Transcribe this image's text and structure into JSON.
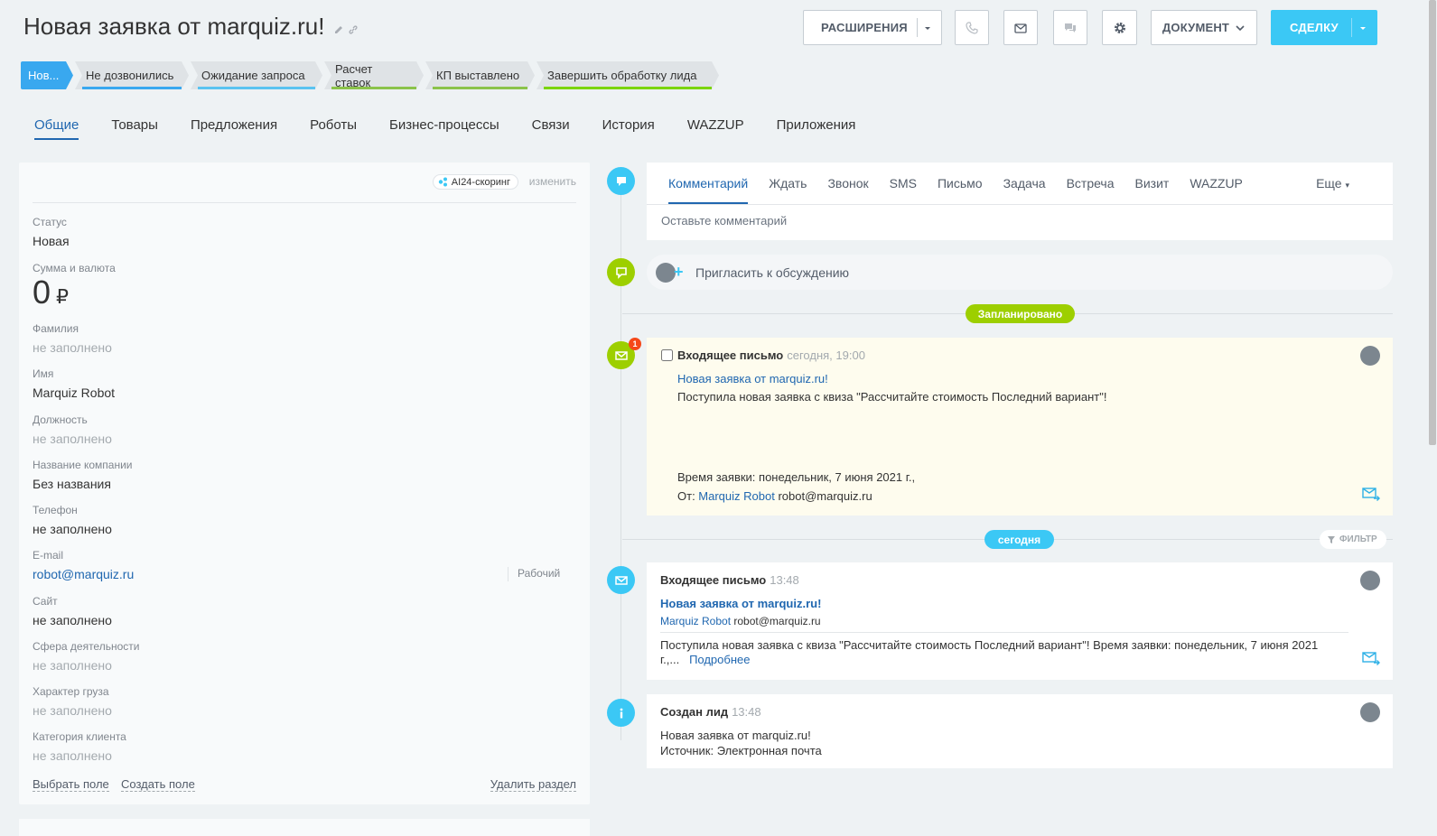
{
  "header": {
    "title": "Новая заявка от  marquiz.ru!",
    "edit_icon": "pencil-icon",
    "link_icon": "link-icon"
  },
  "toolbar": {
    "extensions_label": "РАСШИРЕНИЯ",
    "document_label": "ДОКУМЕНТ",
    "deal_label": "СДЕЛКУ",
    "phone_icon": "phone-icon",
    "mail_icon": "mail-icon",
    "chat_icon": "chat-icon",
    "settings_icon": "gear-icon"
  },
  "stages": [
    {
      "label": "Нов...",
      "color": "#39a8ef",
      "active": true
    },
    {
      "label": "Не дозвонились",
      "color": "#39a8ef"
    },
    {
      "label": "Ожидание запроса",
      "color": "#5ac3f0"
    },
    {
      "label": "Расчет ставок",
      "color": "#8bc34a"
    },
    {
      "label": "КП выставлено",
      "color": "#8bc34a"
    },
    {
      "label": "Завершить обработку лида",
      "color": "#7bd500"
    }
  ],
  "tabs": [
    "Общие",
    "Товары",
    "Предложения",
    "Роботы",
    "Бизнес-процессы",
    "Связи",
    "История",
    "WAZZUP",
    "Приложения"
  ],
  "card": {
    "ai_badge": "AI24-скоринг",
    "change_link": "изменить",
    "fields": {
      "status": {
        "label": "Статус",
        "value": "Новая"
      },
      "amount": {
        "label": "Сумма и валюта",
        "value": "0",
        "currency": "₽"
      },
      "last_name": {
        "label": "Фамилия",
        "value": "не заполнено"
      },
      "first_name": {
        "label": "Имя",
        "value": "Marquiz Robot"
      },
      "position": {
        "label": "Должность",
        "value": "не заполнено"
      },
      "company": {
        "label": "Название компании",
        "value": "Без названия"
      },
      "phone": {
        "label": "Телефон",
        "value": "не заполнено"
      },
      "email": {
        "label": "E-mail",
        "value": "robot@marquiz.ru",
        "type": "Рабочий"
      },
      "site": {
        "label": "Сайт",
        "value": "не заполнено"
      },
      "sphere": {
        "label": "Сфера деятельности",
        "value": "не заполнено"
      },
      "cargo": {
        "label": "Характер груза",
        "value": "не заполнено"
      },
      "category": {
        "label": "Категория клиента",
        "value": "не заполнено"
      }
    },
    "choose_field": "Выбрать поле",
    "create_field": "Создать поле",
    "delete_section": "Удалить раздел"
  },
  "timeline": {
    "editor_tabs": [
      "Комментарий",
      "Ждать",
      "Звонок",
      "SMS",
      "Письмо",
      "Задача",
      "Встреча",
      "Визит",
      "WAZZUP"
    ],
    "editor_more": "Еще",
    "comment_placeholder": "Оставьте комментарий",
    "invite_label": "Пригласить к обсуждению",
    "planned_label": "Запланировано",
    "today_label": "сегодня",
    "filter_label": "ФИЛЬТР",
    "planned_item": {
      "badge": "1",
      "title": "Входящее письмо",
      "time": "сегодня, 19:00",
      "subject": "Новая заявка от marquiz.ru!",
      "body": "Поступила новая заявка с квиза \"Рассчитайте стоимость Последний вариант\"!",
      "request_time": "Время заявки: понедельник, 7 июня 2021 г.,",
      "from_prefix": "От: ",
      "from_name": "Marquiz Robot",
      "from_email": "robot@marquiz.ru"
    },
    "mail_item": {
      "title": "Входящее письмо",
      "time": "13:48",
      "subject": "Новая заявка от marquiz.ru!",
      "from_name": "Marquiz Robot",
      "from_email": "robot@marquiz.ru",
      "body_line1": "Поступила новая заявка с квиза \"Рассчитайте стоимость Последний вариант\"! Время заявки: понедельник, 7 июня 2021",
      "body_line2": "г.,...",
      "more": "Подробнее"
    },
    "lead_item": {
      "title": "Создан лид",
      "time": "13:48",
      "line1": "Новая заявка от marquiz.ru!",
      "line2": "Источник: Электронная почта"
    }
  }
}
